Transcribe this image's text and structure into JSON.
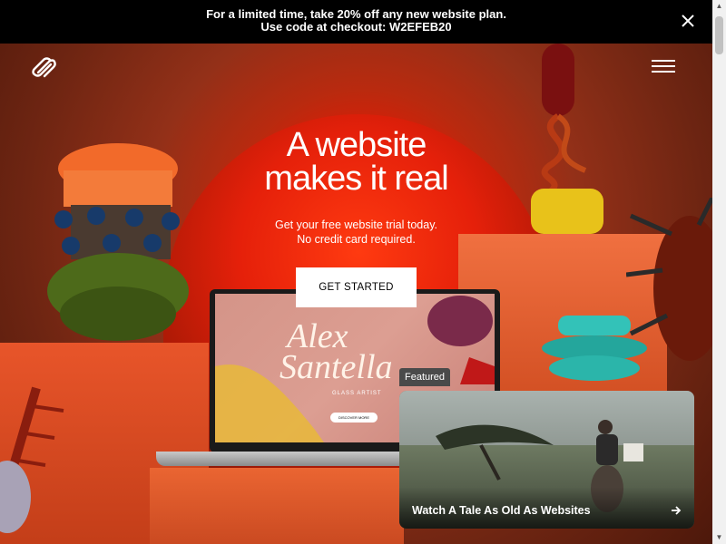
{
  "banner": {
    "line1": "For a limited time, take 20% off any new website plan.",
    "line2": "Use code at checkout: W2EFEB20",
    "close_icon": "close-icon"
  },
  "header": {
    "logo_icon": "squarespace-logo",
    "menu_icon": "hamburger-menu-icon"
  },
  "hero": {
    "title_line1": "A website",
    "title_line2": "makes it real",
    "subtitle_line1": "Get your free website trial today.",
    "subtitle_line2": "No credit card required.",
    "cta_label": "GET STARTED"
  },
  "laptop": {
    "name_line1": "Alex",
    "name_line2": "Santella",
    "role": "GLASS ARTIST",
    "button": "DISCOVER MORE"
  },
  "featured": {
    "badge": "Featured",
    "title": "Watch A Tale As Old As Websites",
    "arrow_icon": "arrow-right-icon"
  },
  "colors": {
    "banner_bg": "#000000",
    "hero_red": "#e01b05",
    "cta_bg": "#ffffff"
  }
}
